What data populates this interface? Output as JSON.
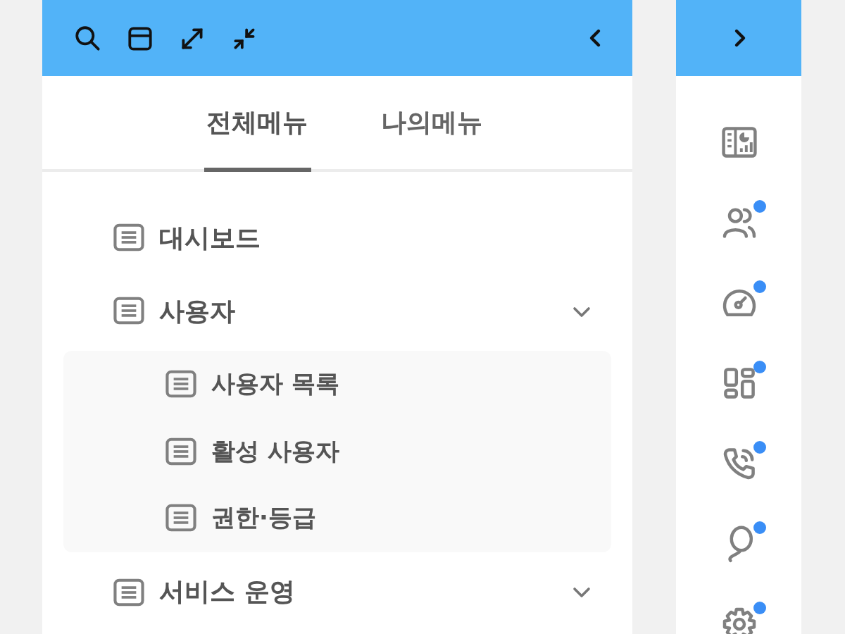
{
  "tabs": [
    {
      "label": "전체메뉴",
      "selected": true
    },
    {
      "label": "나의메뉴",
      "selected": false
    }
  ],
  "menu": [
    {
      "label": "대시보드",
      "kind": "link"
    },
    {
      "label": "사용자",
      "kind": "group",
      "expanded": true,
      "children": [
        {
          "label": "사용자 목록"
        },
        {
          "label": "활성 사용자"
        },
        {
          "label": "권한·등급"
        }
      ]
    },
    {
      "label": "서비스 운영",
      "kind": "group",
      "expanded": false
    }
  ],
  "rail": [
    {
      "badge": false
    },
    {
      "badge": true
    },
    {
      "badge": true
    },
    {
      "badge": true
    },
    {
      "badge": true
    },
    {
      "badge": true
    },
    {
      "badge": true
    }
  ]
}
